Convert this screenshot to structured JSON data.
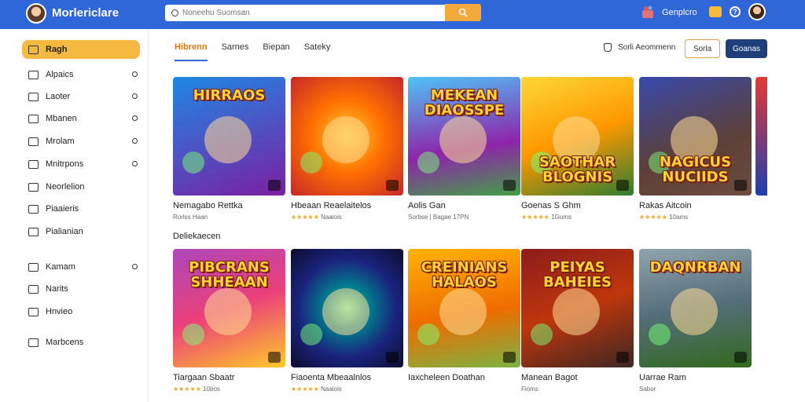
{
  "header": {
    "app_title": "Morlericlare",
    "search_placeholder": "Noneehu Suomsan",
    "account_label": "Genplcro",
    "brand_color": "#2f66d8",
    "accent_color": "#f4a93b"
  },
  "sidebar": {
    "items": [
      {
        "label": "Ragh",
        "icon": "home-icon",
        "active": true,
        "has_dot": false
      },
      {
        "label": "Alpaics",
        "icon": "calendar-icon",
        "active": false,
        "has_dot": true
      },
      {
        "label": "Laoter",
        "icon": "mail-icon",
        "active": false,
        "has_dot": true
      },
      {
        "label": "Mbanen",
        "icon": "chat-icon",
        "active": false,
        "has_dot": true
      },
      {
        "label": "Mrolam",
        "icon": "shield-icon",
        "active": false,
        "has_dot": true
      },
      {
        "label": "Mnitrpons",
        "icon": "inbox-icon",
        "active": false,
        "has_dot": true
      },
      {
        "label": "Neorlelion",
        "icon": "image-icon",
        "active": false,
        "has_dot": false
      },
      {
        "label": "Piaaieris",
        "icon": "pencil-icon",
        "active": false,
        "has_dot": false
      },
      {
        "label": "Pialianian",
        "icon": "share-icon",
        "active": false,
        "has_dot": false
      },
      {
        "label": "Kamam",
        "icon": "briefcase-icon",
        "active": false,
        "has_dot": true
      },
      {
        "label": "Narits",
        "icon": "card-icon",
        "active": false,
        "has_dot": false
      },
      {
        "label": "Hnvieo",
        "icon": "plus-box-icon",
        "active": false,
        "has_dot": false
      },
      {
        "label": "Marbcens",
        "icon": "envelope-icon",
        "active": false,
        "has_dot": false
      }
    ]
  },
  "tabs": [
    "Hibrenn",
    "Sarnes",
    "Biepan",
    "Sateky"
  ],
  "toolbar": {
    "status_text": "Sorli Aeommenn",
    "outline_button": "Sorla",
    "primary_button": "Goanas"
  },
  "section_title": "Deliekaecen",
  "row1": [
    {
      "name": "Nemagabo Rettka",
      "meta_stars": "",
      "meta": "Rorlss Haan",
      "art_text": "HIRRAOS",
      "bg": "linear-gradient(160deg,#1e88e5,#7b1fa2)"
    },
    {
      "name": "Hbeaan Reaelaitelos",
      "meta_stars": "★★★★★",
      "meta": "Naaiois",
      "art_text": "",
      "bg": "radial-gradient(circle,#ffcc33 0%,#ff6f00 45%,#c62828 100%)"
    },
    {
      "name": "Aolis Gan",
      "meta_stars": "",
      "meta": "Sorbse | Bagae 17PN",
      "art_text": "MEKEAN DIAOSSPE",
      "bg": "linear-gradient(170deg,#4fc3f7,#8e24aa 60%,#43a047)"
    },
    {
      "name": "Goenas S Ghm",
      "meta_stars": "★★★★★",
      "meta": "1Gums",
      "art_text": "SAOTHAR BLOGNIS",
      "bg": "linear-gradient(160deg,#fdd835,#ff9800 50%,#2e7d32)"
    },
    {
      "name": "Rakas Aitcoin",
      "meta_stars": "★★★★★",
      "meta": "10ams",
      "art_text": "NAGICUS NUCIIDS",
      "bg": "linear-gradient(160deg,#3949ab,#5d4037 60%,#6d4c41)"
    }
  ],
  "row2": [
    {
      "name": "Tiargaan Sbaatr",
      "meta_stars": "★★★★★",
      "meta": "10bos",
      "art_text": "PIBCRANS SHHEAAN",
      "bg": "linear-gradient(160deg,#ab47bc,#ec407a 50%,#ffca28)"
    },
    {
      "name": "Fiaoenta Mbeaalnlos",
      "meta_stars": "★★★★★",
      "meta": "Naaiois",
      "art_text": "",
      "bg": "radial-gradient(circle,#69f0ae 0%,#00838f 25%,#1a237e 60%,#0d0d2b 100%)"
    },
    {
      "name": "Iaxcheleen Doathan",
      "meta_stars": "",
      "meta": "",
      "art_text": "CREINIANS HALAOS",
      "bg": "linear-gradient(170deg,#ffb300,#ef6c00 55%,#7cb342)"
    },
    {
      "name": "Manean Bagot",
      "meta_stars": "",
      "meta": "Fioms",
      "art_text": "PEIYAS BAHEIES",
      "bg": "linear-gradient(160deg,#8d1c1c,#bf360c 50%,#3e2723)"
    },
    {
      "name": "Uarrae Ram",
      "meta_stars": "",
      "meta": "Sabor",
      "art_text": "DAQNRBAN",
      "bg": "linear-gradient(170deg,#90a4ae,#546e7a 50%,#33691e)"
    }
  ]
}
